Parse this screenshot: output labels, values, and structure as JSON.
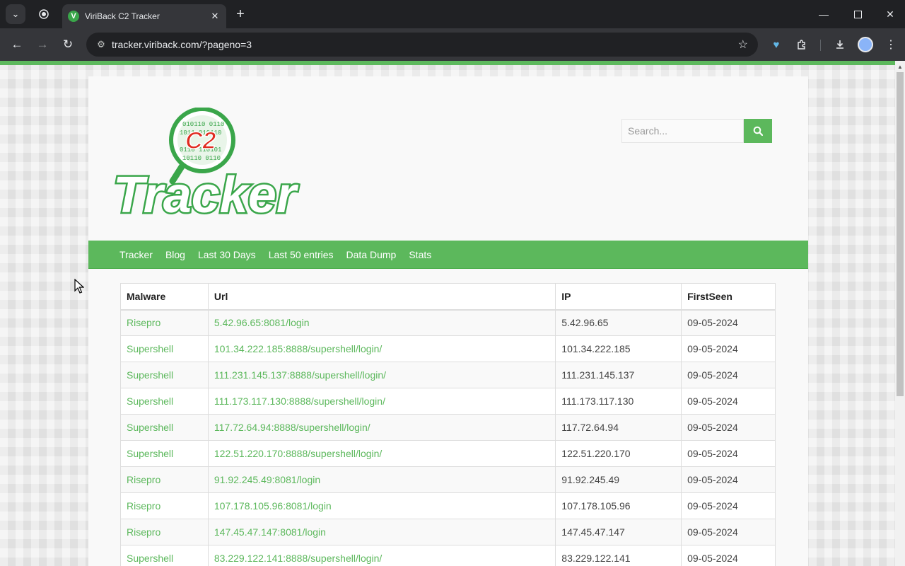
{
  "browser": {
    "tab_title": "ViriBack C2 Tracker",
    "favicon_letter": "V",
    "url": "tracker.viriback.com/?pageno=3"
  },
  "site": {
    "logo_top_text": "C2",
    "logo_word": "Tracker",
    "search_placeholder": "Search...",
    "accent_color": "#5cb85c",
    "logo_red": "#e02b20"
  },
  "nav": {
    "items": [
      {
        "label": "Tracker"
      },
      {
        "label": "Blog"
      },
      {
        "label": "Last 30 Days"
      },
      {
        "label": "Last 50 entries"
      },
      {
        "label": "Data Dump"
      },
      {
        "label": "Stats"
      }
    ]
  },
  "table": {
    "headers": [
      "Malware",
      "Url",
      "IP",
      "FirstSeen"
    ],
    "rows": [
      [
        "Risepro",
        "5.42.96.65:8081/login",
        "5.42.96.65",
        "09-05-2024"
      ],
      [
        "Supershell",
        "101.34.222.185:8888/supershell/login/",
        "101.34.222.185",
        "09-05-2024"
      ],
      [
        "Supershell",
        "111.231.145.137:8888/supershell/login/",
        "111.231.145.137",
        "09-05-2024"
      ],
      [
        "Supershell",
        "111.173.117.130:8888/supershell/login/",
        "111.173.117.130",
        "09-05-2024"
      ],
      [
        "Supershell",
        "117.72.64.94:8888/supershell/login/",
        "117.72.64.94",
        "09-05-2024"
      ],
      [
        "Supershell",
        "122.51.220.170:8888/supershell/login/",
        "122.51.220.170",
        "09-05-2024"
      ],
      [
        "Risepro",
        "91.92.245.49:8081/login",
        "91.92.245.49",
        "09-05-2024"
      ],
      [
        "Risepro",
        "107.178.105.96:8081/login",
        "107.178.105.96",
        "09-05-2024"
      ],
      [
        "Risepro",
        "147.45.47.147:8081/login",
        "147.45.47.147",
        "09-05-2024"
      ],
      [
        "Supershell",
        "83.229.122.141:8888/supershell/login/",
        "83.229.122.141",
        "09-05-2024"
      ]
    ]
  }
}
